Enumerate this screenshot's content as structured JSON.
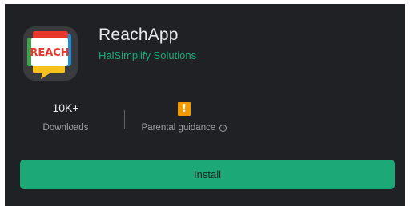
{
  "app": {
    "title": "ReachApp",
    "developer": "HalSimplify Solutions",
    "logo_text": "REACH",
    "icon": "reach-speech-bubble-logo"
  },
  "stats": {
    "downloads": {
      "value": "10K+",
      "label": "Downloads"
    },
    "content_rating": {
      "badge": "!",
      "label": "Parental guidance",
      "info_glyph": "i"
    }
  },
  "actions": {
    "install_label": "Install"
  },
  "colors": {
    "background": "#202124",
    "accent": "#1da977",
    "rating_badge": "#f29900",
    "text_primary": "#e8eaed",
    "text_secondary": "#9aa0a6"
  }
}
